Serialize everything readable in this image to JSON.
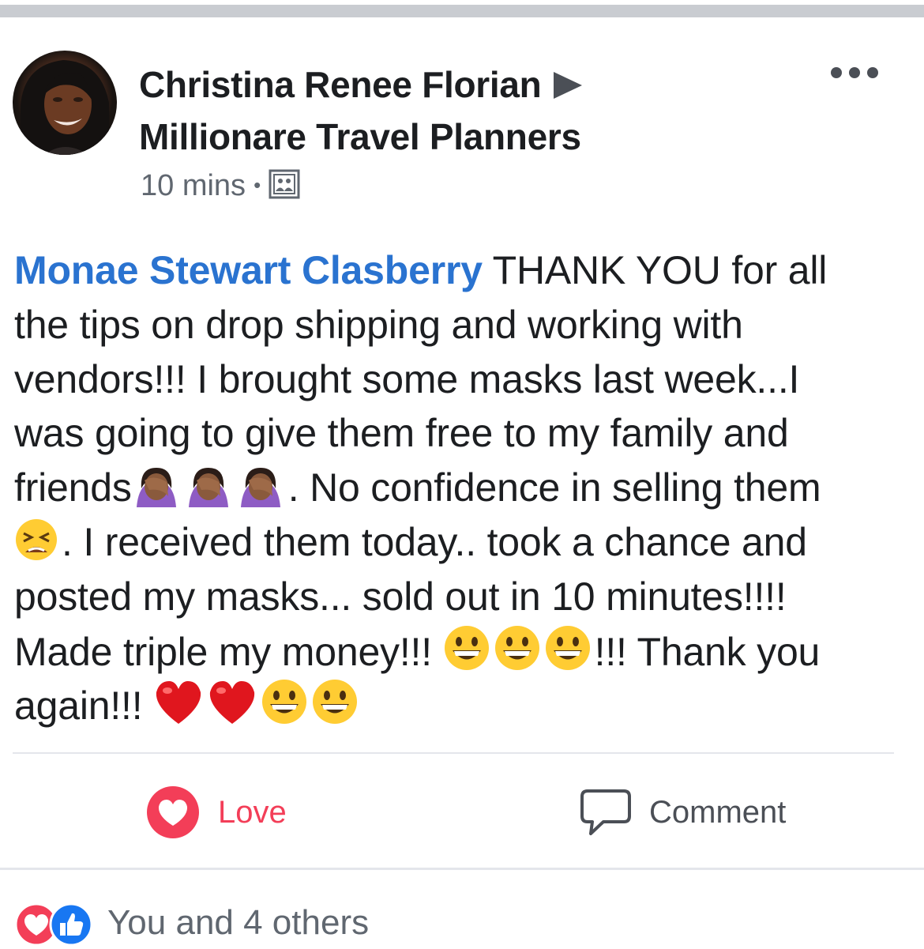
{
  "post": {
    "author": "Christina Renee Florian",
    "group": "Millionare Travel Planners",
    "time": "10 mins",
    "audience_icon": "group-audience-icon",
    "mention": "Monae Stewart Clasberry",
    "text_lines": [
      " THANK YOU for all",
      "the tips on drop shipping and working with",
      "vendors!!! I brought some masks last week...I",
      "was going to give them free to my family and",
      "friends",
      ". No confidence in selling them",
      ".  I received them today.. took a chance and",
      "posted my masks... sold out in 10 minutes!!!!",
      "Made triple my money!!! ",
      "!!! Thank you",
      "again!!! "
    ],
    "emoji": {
      "facepalm": "woman-facepalming-emoji",
      "tired": "tired-face-emoji",
      "grin": "grinning-face-emoji",
      "heart": "red-heart-emoji"
    }
  },
  "actions": {
    "love_label": "Love",
    "comment_label": "Comment"
  },
  "reactions": {
    "summary": "You and 4 others"
  },
  "colors": {
    "mention": "#2a73d0",
    "love": "#f33e58",
    "like": "#1877f2",
    "text": "#1c1e21",
    "muted": "#606770"
  }
}
